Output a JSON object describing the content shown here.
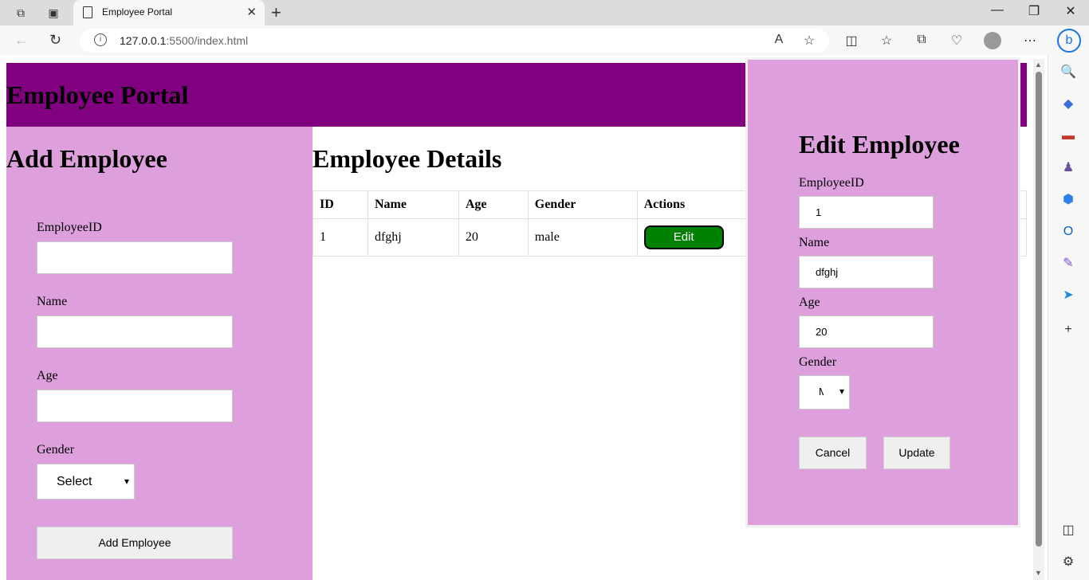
{
  "browser": {
    "tab_title": "Employee Portal",
    "url_host": "127.0.0.1",
    "url_rest": ":5500/index.html"
  },
  "header": {
    "title": "Employee Portal"
  },
  "add_form": {
    "title": "Add Employee",
    "employee_id_label": "EmployeeID",
    "employee_id_value": "",
    "name_label": "Name",
    "name_value": "",
    "age_label": "Age",
    "age_value": "",
    "gender_label": "Gender",
    "gender_value": "Select",
    "submit_label": "Add Employee"
  },
  "details": {
    "title": "Employee Details",
    "columns": [
      "ID",
      "Name",
      "Age",
      "Gender",
      "Actions"
    ],
    "rows": [
      {
        "id": "1",
        "name": "dfghj",
        "age": "20",
        "gender": "male",
        "action": "Edit"
      }
    ]
  },
  "edit_modal": {
    "title": "Edit Employee",
    "employee_id_label": "EmployeeID",
    "employee_id_value": "1",
    "name_label": "Name",
    "name_value": "dfghj",
    "age_label": "Age",
    "age_value": "20",
    "gender_label": "Gender",
    "gender_value": "M",
    "cancel_label": "Cancel",
    "update_label": "Update"
  },
  "colors": {
    "header_bg": "#800080",
    "panel_bg": "#dda0dd",
    "edit_button_bg": "#008000"
  }
}
